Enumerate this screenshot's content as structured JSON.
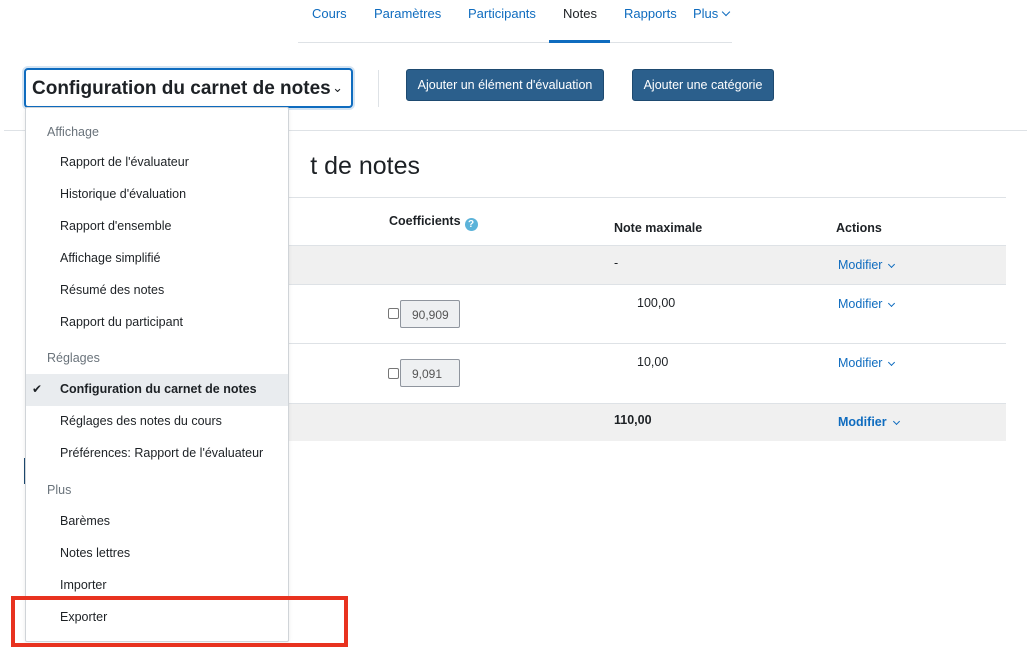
{
  "nav": {
    "tabs": [
      "Cours",
      "Paramètres",
      "Participants",
      "Notes",
      "Rapports",
      "Plus"
    ]
  },
  "action_bar": {
    "select_value": "Configuration du carnet de notes",
    "add_item_button": "Ajouter un élément d'évaluation",
    "add_category_button": "Ajouter une catégorie"
  },
  "heading": {
    "title_visible": "t de notes"
  },
  "table": {
    "headers": {
      "coefficients": "Coefficients",
      "max_grade": "Note maximale",
      "actions": "Actions"
    },
    "category_row": {
      "max_grade": "-",
      "action": "Modifier"
    },
    "items": [
      {
        "coefficient": "90,909",
        "max_grade": "100,00",
        "action": "Modifier"
      },
      {
        "coefficient": "9,091",
        "max_grade": "10,00",
        "action": "Modifier"
      }
    ],
    "total_row": {
      "max_grade": "110,00",
      "action": "Modifier"
    }
  },
  "dropdown": {
    "sections": [
      {
        "header": "Affichage",
        "items": [
          "Rapport de l'évaluateur",
          "Historique d'évaluation",
          "Rapport d'ensemble",
          "Affichage simplifié",
          "Résumé des notes",
          "Rapport du participant"
        ]
      },
      {
        "header": "Réglages",
        "items": [
          "Configuration du carnet de notes",
          "Réglages des notes du cours",
          "Préférences: Rapport de l'évaluateur"
        ]
      },
      {
        "header": "Plus",
        "items": [
          "Barèmes",
          "Notes lettres",
          "Importer",
          "Exporter"
        ]
      }
    ],
    "selected_item": "Configuration du carnet de notes"
  },
  "colors": {
    "accent": "#0f6cbf",
    "button": "#2b5f8c",
    "highlight": "#e8321f"
  }
}
